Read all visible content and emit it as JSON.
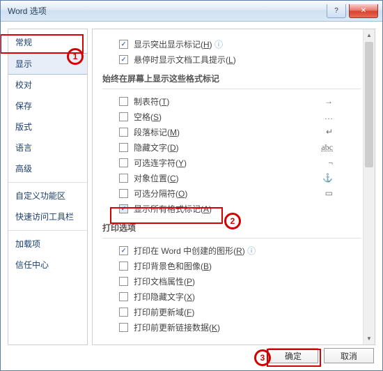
{
  "title": "Word 选项",
  "window_buttons": {
    "help": "?",
    "close": "✕"
  },
  "sidebar": {
    "items": [
      {
        "label": "常规"
      },
      {
        "label": "显示",
        "selected": true
      },
      {
        "label": "校对"
      },
      {
        "label": "保存"
      },
      {
        "label": "版式"
      },
      {
        "label": "语言"
      },
      {
        "label": "高级"
      }
    ],
    "items2": [
      {
        "label": "自定义功能区"
      },
      {
        "label": "快速访问工具栏"
      }
    ],
    "items3": [
      {
        "label": "加载项"
      },
      {
        "label": "信任中心"
      }
    ]
  },
  "top_checks": [
    {
      "checked": true,
      "label": "显示突出显示标记(",
      "mn": "H",
      "suffix": ") "
    },
    {
      "checked": true,
      "label": "悬停时显示文档工具提示(",
      "mn": "L",
      "suffix": ")"
    }
  ],
  "group1_title": "始终在屏幕上显示这些格式标记",
  "marks": [
    {
      "checked": false,
      "label": "制表符(",
      "mn": "T",
      "suffix": ")",
      "ex": "→"
    },
    {
      "checked": false,
      "label": "空格(",
      "mn": "S",
      "suffix": ")",
      "ex": "…"
    },
    {
      "checked": false,
      "label": "段落标记(",
      "mn": "M",
      "suffix": ")",
      "ex": "↵"
    },
    {
      "checked": false,
      "label": "隐藏文字(",
      "mn": "D",
      "suffix": ")",
      "ex": "abc"
    },
    {
      "checked": false,
      "label": "可选连字符(",
      "mn": "Y",
      "suffix": ")",
      "ex": "¬"
    },
    {
      "checked": false,
      "label": "对象位置(",
      "mn": "C",
      "suffix": ")",
      "ex": "⚓"
    },
    {
      "checked": false,
      "label": "可选分隔符(",
      "mn": "O",
      "suffix": ")",
      "ex": "▭"
    },
    {
      "checked": true,
      "hl": true,
      "label": "显示所有格式标记(",
      "mn": "A",
      "suffix": ")",
      "ex": ""
    }
  ],
  "group2_title": "打印选项",
  "print_opts": [
    {
      "checked": true,
      "label": "打印在 Word 中创建的图形(",
      "mn": "R",
      "suffix": ") "
    },
    {
      "checked": false,
      "label": "打印背景色和图像(",
      "mn": "B",
      "suffix": ")"
    },
    {
      "checked": false,
      "label": "打印文档属性(",
      "mn": "P",
      "suffix": ")"
    },
    {
      "checked": false,
      "label": "打印隐藏文字(",
      "mn": "X",
      "suffix": ")"
    },
    {
      "checked": false,
      "label": "打印前更新域(",
      "mn": "F",
      "suffix": ")"
    },
    {
      "checked": false,
      "label": "打印前更新链接数据(",
      "mn": "K",
      "suffix": ")"
    }
  ],
  "buttons": {
    "ok": "确定",
    "cancel": "取消"
  },
  "annotations": {
    "a1": "1",
    "a2": "2",
    "a3": "3"
  }
}
